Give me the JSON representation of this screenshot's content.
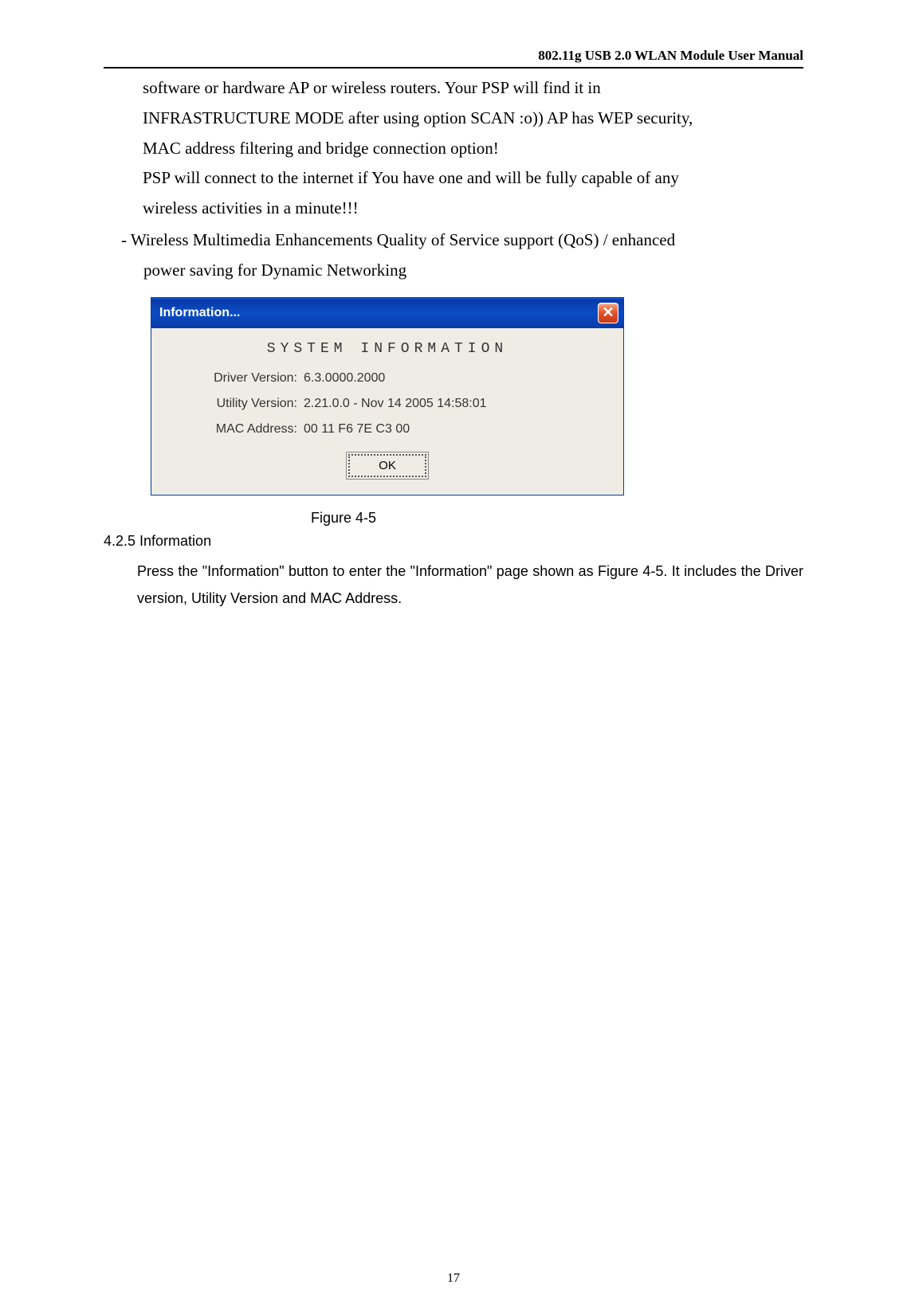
{
  "header": {
    "title": "802.11g USB 2.0 WLAN Module User Manual"
  },
  "body": {
    "p1": "software or hardware AP or wireless routers. Your PSP will find it in",
    "p2": "INFRASTRUCTURE MODE after using option SCAN :o)) AP has WEP security,",
    "p3": "MAC address filtering and bridge connection option!",
    "p4": "PSP will connect to the internet if You have one and will be fully capable of any",
    "p5": "wireless activities in a minute!!!",
    "bullet1": "- Wireless Multimedia Enhancements Quality of Service support (QoS) / enhanced",
    "bullet1b": "power saving for Dynamic Networking"
  },
  "dialog": {
    "title": "Information...",
    "heading": "SYSTEM INFORMATION",
    "rows": [
      {
        "label": "Driver Version:",
        "value": "6.3.0000.2000"
      },
      {
        "label": "Utility Version:",
        "value": "2.21.0.0 - Nov 14 2005 14:58:01"
      },
      {
        "label": "MAC Address:",
        "value": "00 11 F6 7E C3 00"
      }
    ],
    "ok_label": "OK"
  },
  "caption": "Figure 4-5",
  "section": {
    "num": "4.2.5  Information",
    "text": "Press the \"Information\" button to enter the \"Information\" page shown as Figure 4-5. It includes the Driver version, Utility Version and MAC Address."
  },
  "page_number": "17"
}
